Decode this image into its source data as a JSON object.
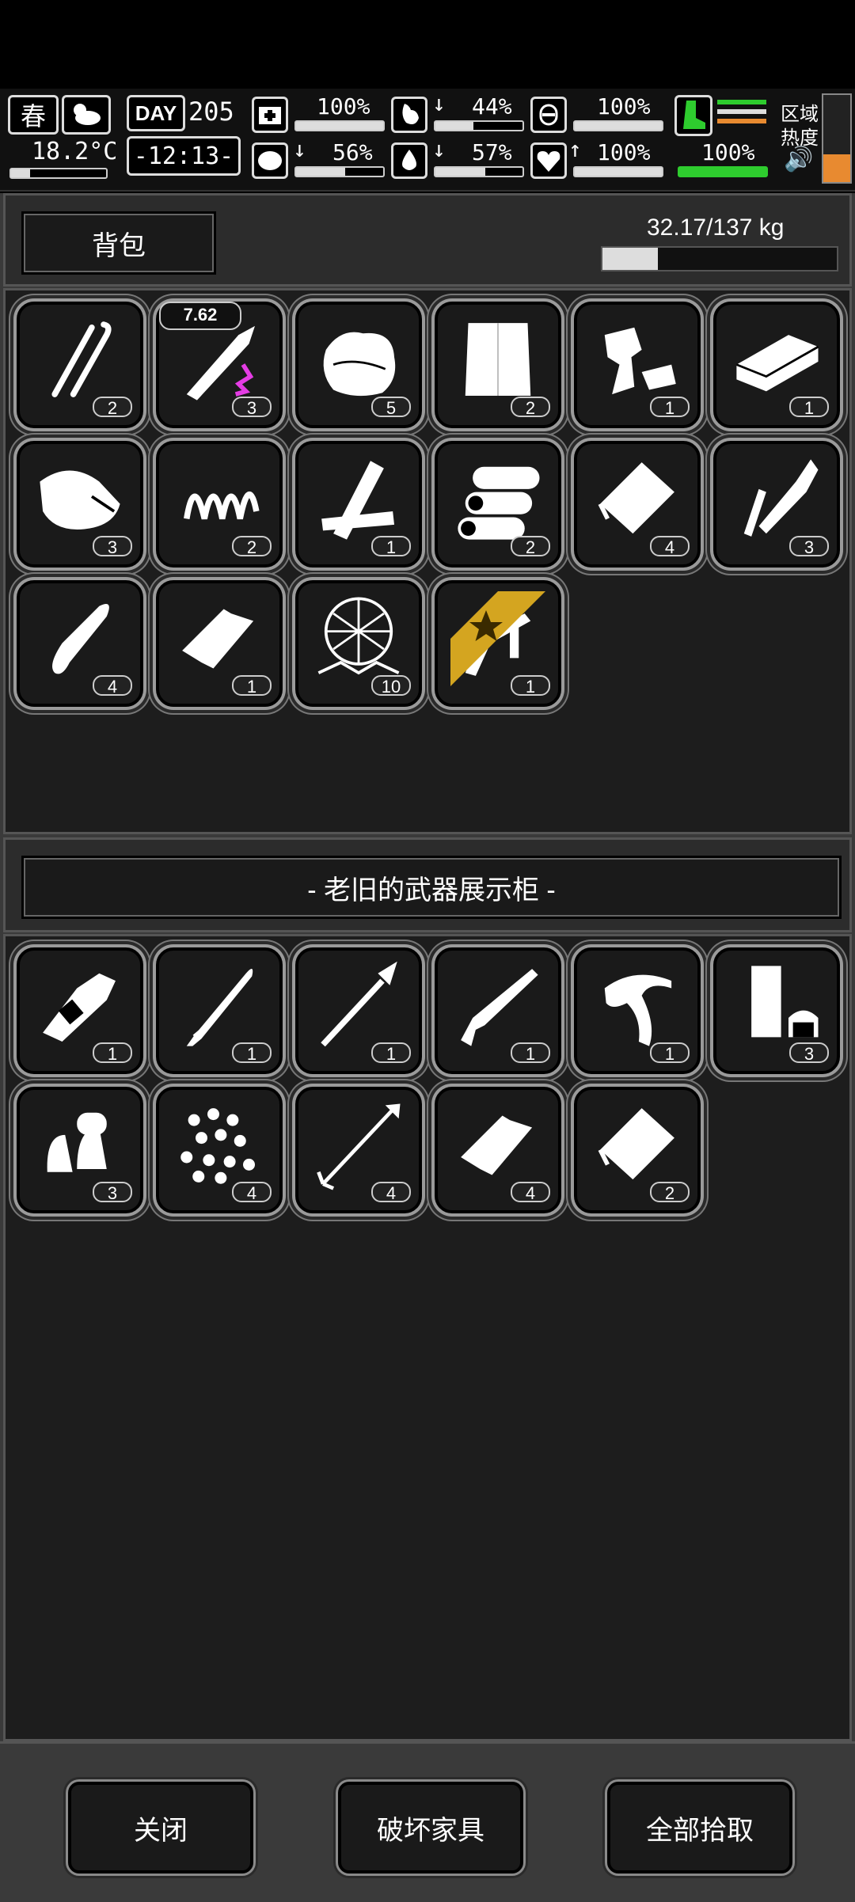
{
  "hud": {
    "season": "春",
    "temperature": "18.2°C",
    "day_label": "DAY",
    "day_number": "205",
    "time": "-12:13-",
    "health_pct": "100%",
    "stomach_pct": "44%",
    "fatigue_pct": "100%",
    "brain_pct": "56%",
    "water_pct": "57%",
    "heart_pct": "100%",
    "stamina_pct": "100%",
    "zone_label_1": "区域",
    "zone_label_2": "热度",
    "bar_levels": {
      "health": 1.0,
      "stomach": 0.44,
      "fatigue": 1.0,
      "brain": 0.56,
      "water": 0.57,
      "heart": 1.0,
      "stamina": 1.0
    },
    "colors": {
      "stamina": "#2ecc2e",
      "zone_heat": "#e88a30",
      "down_arrow": "#e22222",
      "up_arrow": "#22dd22"
    }
  },
  "backpack": {
    "title": "背包",
    "weight": "32.17/137 kg",
    "weight_fraction": 0.235,
    "items": [
      {
        "icon": "lockpick-icon",
        "count": "2"
      },
      {
        "icon": "rifle-bullet-icon",
        "count": "3",
        "caliber": "7.62"
      },
      {
        "icon": "cloth-icon",
        "count": "5"
      },
      {
        "icon": "paper-icon",
        "count": "2"
      },
      {
        "icon": "scrap-parts-icon",
        "count": "1"
      },
      {
        "icon": "metal-bar-icon",
        "count": "1"
      },
      {
        "icon": "bag-icon",
        "count": "3"
      },
      {
        "icon": "spring-icon",
        "count": "2"
      },
      {
        "icon": "planks-icon",
        "count": "1"
      },
      {
        "icon": "logs-icon",
        "count": "2"
      },
      {
        "icon": "packet-icon",
        "count": "4"
      },
      {
        "icon": "sharpener-icon",
        "count": "3"
      },
      {
        "icon": "bullet-icon",
        "count": "4"
      },
      {
        "icon": "can-icon",
        "count": "1"
      },
      {
        "icon": "net-icon",
        "count": "10"
      },
      {
        "icon": "caliper-icon",
        "count": "1",
        "starred": true
      }
    ]
  },
  "container": {
    "title": "- 老旧的武器展示柜 -",
    "items": [
      {
        "icon": "knife-sheath-icon",
        "count": "1"
      },
      {
        "icon": "katana-icon",
        "count": "1"
      },
      {
        "icon": "spear-icon",
        "count": "1"
      },
      {
        "icon": "shotgun-icon",
        "count": "1"
      },
      {
        "icon": "hook-blade-icon",
        "count": "1"
      },
      {
        "icon": "shells-icon",
        "count": "3"
      },
      {
        "icon": "bullets-pair-icon",
        "count": "3"
      },
      {
        "icon": "pellets-icon",
        "count": "4"
      },
      {
        "icon": "arrow-icon",
        "count": "4"
      },
      {
        "icon": "can-icon",
        "count": "4"
      },
      {
        "icon": "packet-icon",
        "count": "2"
      }
    ]
  },
  "buttons": {
    "close": "关闭",
    "destroy": "破坏家具",
    "take_all": "全部拾取"
  }
}
